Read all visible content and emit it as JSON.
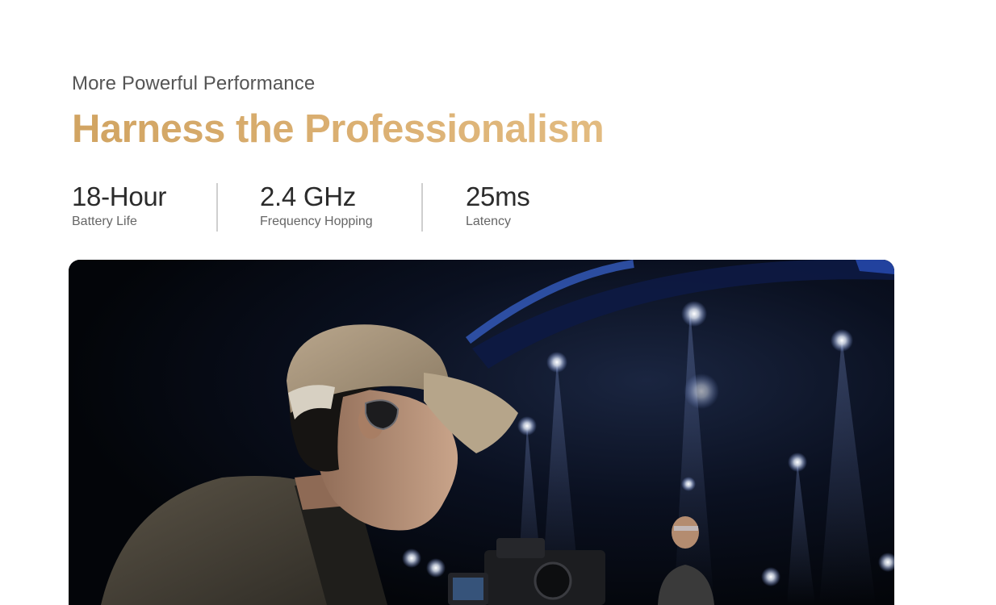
{
  "section": {
    "eyebrow": "More Powerful Performance",
    "headline": "Harness the Professionalism"
  },
  "stats": [
    {
      "value": "18-Hour",
      "label": "Battery Life"
    },
    {
      "value": "2.4 GHz",
      "label": "Frequency Hopping"
    },
    {
      "value": "25ms",
      "label": "Latency"
    }
  ],
  "colors": {
    "headline_gold": "#d4a767",
    "stat_text": "#2b2b2b",
    "label_text": "#666666",
    "divider": "#cfcfcf",
    "hero_background": "#05070d"
  },
  "hero_image": {
    "icon": "photo-camera-operator-stage"
  }
}
